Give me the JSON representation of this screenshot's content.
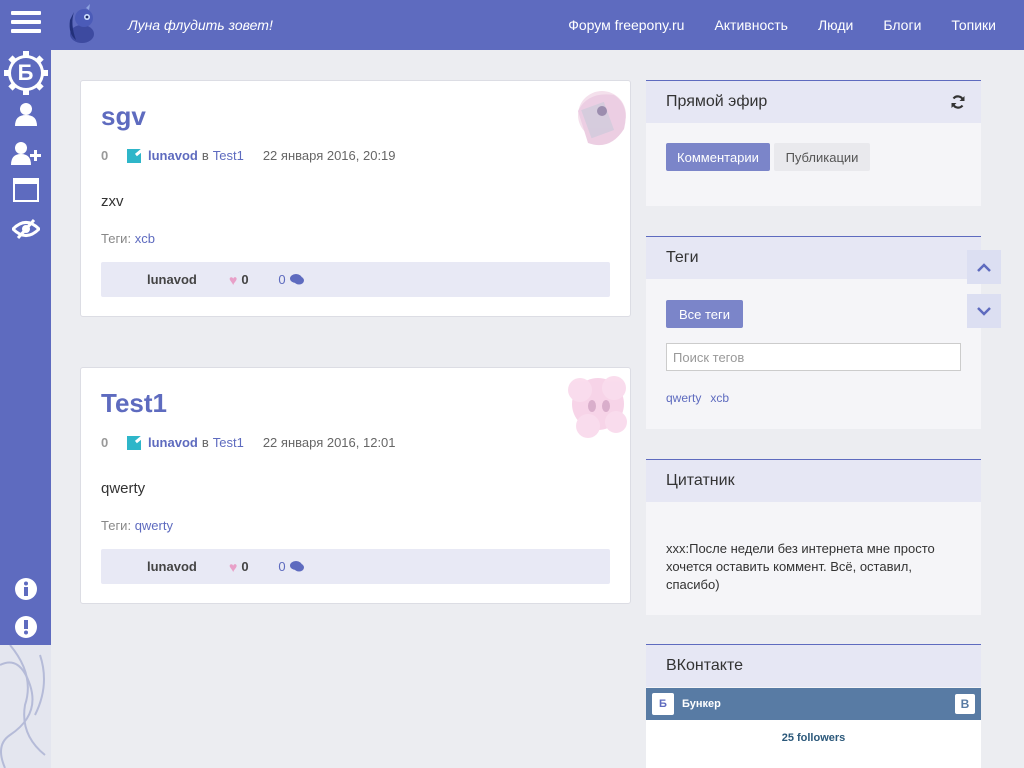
{
  "header": {
    "slogan": "Луна флудить зовет!",
    "nav": [
      "Форум freepony.ru",
      "Активность",
      "Люди",
      "Блоги",
      "Топики"
    ]
  },
  "sidebar": {
    "badge_letter": "Б",
    "icons": [
      "menu-icon",
      "user-icon",
      "user-add-icon",
      "window-icon",
      "eye-slash-icon",
      "info-icon",
      "alert-icon"
    ]
  },
  "posts": [
    {
      "title": "sgv",
      "rating": "0",
      "author": "lunavod",
      "in": "в",
      "blog": "Test1",
      "date": "22 января 2016, 20:19",
      "body": "zxv",
      "tags_label": "Теги:",
      "tags": "xcb",
      "footer_author": "lunavod",
      "likes": "0",
      "comments": "0"
    },
    {
      "title": "Test1",
      "rating": "0",
      "author": "lunavod",
      "in": "в",
      "blog": "Test1",
      "date": "22 января 2016, 12:01",
      "body": "qwerty",
      "tags_label": "Теги:",
      "tags": "qwerty",
      "footer_author": "lunavod",
      "likes": "0",
      "comments": "0"
    }
  ],
  "widgets": {
    "live": {
      "title": "Прямой эфир",
      "tab_comments": "Комментарии",
      "tab_publications": "Публикации"
    },
    "tags": {
      "title": "Теги",
      "all_tags": "Все теги",
      "search_placeholder": "Поиск тегов",
      "cloud": [
        "qwerty",
        "xcb"
      ]
    },
    "quotes": {
      "title": "Цитатник",
      "text": "xxx:После недели без интернета мне просто хочется оставить коммент. Всё, оставил, спасибо)"
    },
    "vk": {
      "title": "ВКонтакте",
      "group_name": "Бункер",
      "avatar_letter": "Б",
      "logo_letter": "B",
      "followers": "25 followers"
    }
  },
  "colors": {
    "brand": "#5e6bbf",
    "vk": "#587ba4",
    "heart": "#e8a0c8"
  }
}
